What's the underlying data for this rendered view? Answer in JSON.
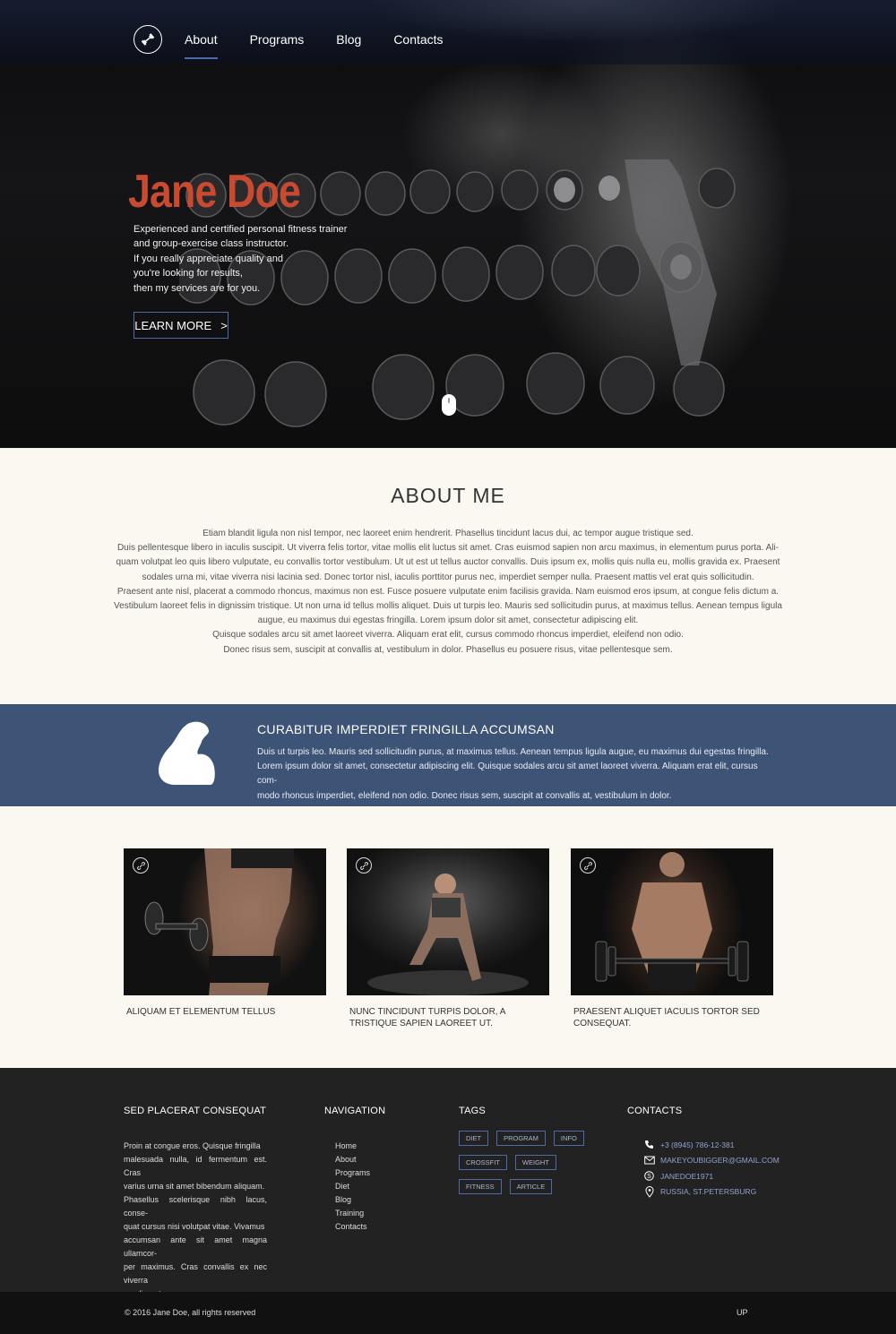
{
  "nav": {
    "items": [
      {
        "label": "About",
        "active": true
      },
      {
        "label": "Programs"
      },
      {
        "label": "Blog"
      },
      {
        "label": "Contacts"
      }
    ]
  },
  "hero": {
    "name": "Jane Doe",
    "intro_lines": [
      "Experienced and certified personal fitness trainer",
      "and group-exercise class instructor.",
      "If you really appreciate quality and",
      "you're looking for results,",
      "then my services are for you."
    ],
    "cta_label": "LEARN MORE",
    "cta_arrow": ">"
  },
  "about": {
    "title": "ABOUT ME",
    "lines": [
      "Etiam blandit ligula non nisl tempor, nec laoreet enim hendrerit. Phasellus tincidunt lacus dui, ac tempor augue tristique sed.",
      "Duis pellentesque libero in iaculis suscipit. Ut viverra felis tortor, vitae mollis elit luctus sit amet. Cras euismod sapien non arcu maximus, in elementum purus porta. Ali-",
      "quam volutpat leo quis libero vulputate, eu convallis tortor vestibulum. Ut ut est ut tellus auctor convallis. Duis ipsum ex, mollis quis nulla eu, mollis gravida ex. Praesent",
      "sodales urna mi, vitae viverra nisi lacinia sed. Donec tortor nisl, iaculis porttitor purus nec, imperdiet semper nulla. Praesent mattis vel erat quis sollicitudin.",
      "Praesent ante nisl, placerat a commodo rhoncus, maximus non est. Fusce posuere vulputate enim facilisis gravida. Nam euismod eros ipsum, at congue felis dictum a.",
      "Vestibulum laoreet felis in dignissim tristique. Ut non urna id tellus mollis aliquet. Duis ut turpis leo. Mauris sed sollicitudin purus, at maximus tellus. Aenean tempus ligula",
      "augue, eu maximus dui egestas fringilla. Lorem ipsum dolor sit amet, consectetur adipiscing elit.",
      "Quisque sodales arcu sit amet laoreet viverra. Aliquam erat elit, cursus commodo rhoncus imperdiet, eleifend non odio.",
      "Donec risus sem, suscipit at convallis at, vestibulum in dolor. Phasellus eu posuere risus, vitae pellentesque sem."
    ]
  },
  "band": {
    "title": "CURABITUR IMPERDIET FRINGILLA ACCUMSAN",
    "lines": [
      "Duis ut turpis leo. Mauris sed sollicitudin purus, at maximus tellus. Aenean tempus ligula augue, eu maximus dui egestas fringilla.",
      "Lorem ipsum dolor sit amet, consectetur adipiscing elit. Quisque sodales arcu sit amet laoreet viverra. Aliquam erat elit, cursus com-",
      "modo rhoncus imperdiet, eleifend non odio. Donec risus sem, suscipit at convallis at, vestibulum in dolor."
    ]
  },
  "cards": [
    {
      "caption": "ALIQUAM ET ELEMENTUM TELLUS"
    },
    {
      "caption": "NUNC TINCIDUNT TURPIS DOLOR, A TRISTIQUE SAPIEN LAOREET UT."
    },
    {
      "caption": "PRAESENT ALIQUET IACULIS TORTOR SED CONSEQUAT."
    }
  ],
  "footer": {
    "col1_title": "SED PLACERAT CONSEQUAT",
    "col1_lines": [
      "Proin at congue eros. Quisque fringilla",
      "malesuada nulla, id fermentum est. Cras",
      "varius urna sit amet bibendum aliquam.",
      "Phasellus scelerisque nibh lacus, conse-",
      "quat cursus nisi volutpat vitae. Vivamus",
      "accumsan ante sit amet magna ullamcor-",
      "per maximus. Cras convallis ex nec viverra",
      "condimentum."
    ],
    "nav_title": "NAVIGATION",
    "nav_items": [
      "Home",
      "About",
      "Programs",
      "Diet",
      "Blog",
      "Training",
      "Contacts"
    ],
    "tags_title": "TAGS",
    "tags": [
      [
        "DIET",
        "PROGRAM",
        "INFO"
      ],
      [
        "CROSSFIT",
        "WEIGHT"
      ],
      [
        "FITNESS",
        "ARTICLE"
      ]
    ],
    "contacts_title": "CONTACTS",
    "contacts": [
      {
        "icon": "phone-icon",
        "text": "+3 (8945) 786-12-381"
      },
      {
        "icon": "mail-icon",
        "text": "MAKEYOUBIGGER@GMAIL.COM"
      },
      {
        "icon": "skype-icon",
        "text": "JANEDOE1971"
      },
      {
        "icon": "location-pin-icon",
        "text": "RUSSIA, ST.PETERSBURG"
      }
    ],
    "copyright": "© 2016 Jane Doe, all rights reserved",
    "up_label": "UP"
  },
  "colors": {
    "accent_blue": "#4f6aa8",
    "band_blue": "#3e5477",
    "name_orange": "#c84a30",
    "footer_bg": "#222222"
  }
}
